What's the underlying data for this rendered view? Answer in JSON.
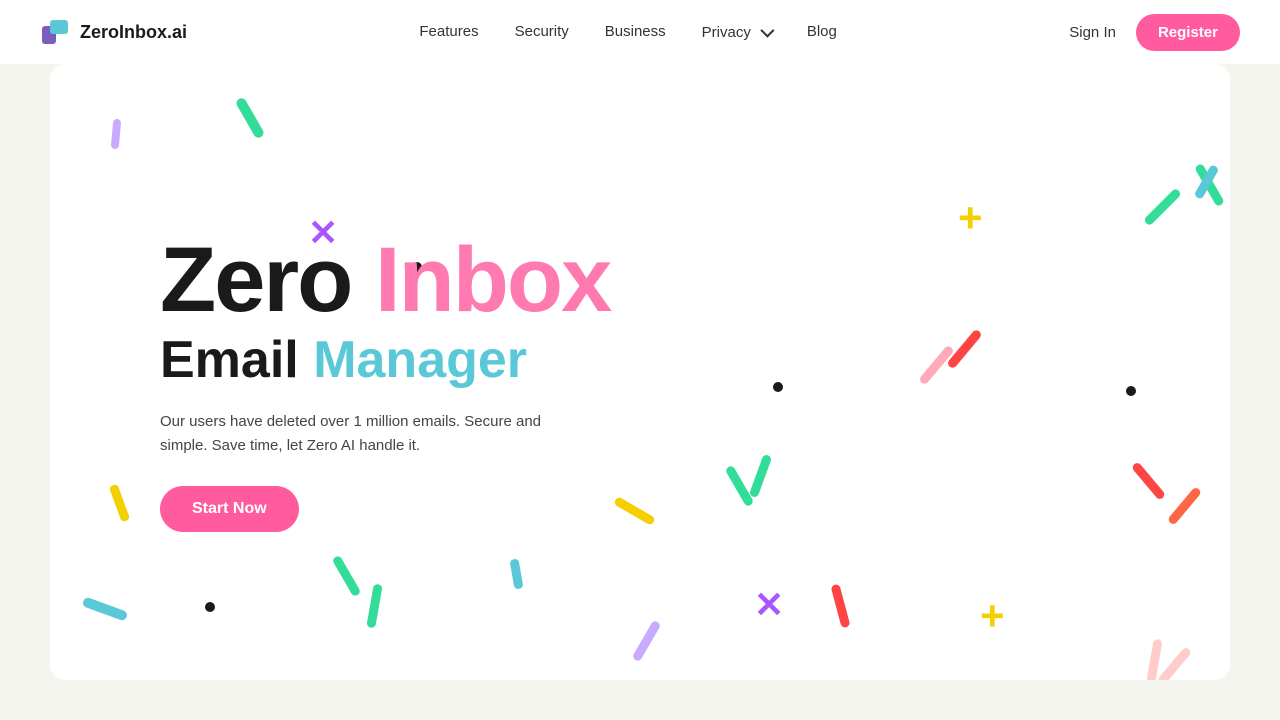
{
  "nav": {
    "logo_text": "ZeroInbox.ai",
    "links": [
      {
        "label": "Features",
        "id": "features"
      },
      {
        "label": "Security",
        "id": "security"
      },
      {
        "label": "Business",
        "id": "business"
      },
      {
        "label": "Privacy",
        "id": "privacy",
        "has_dropdown": true
      },
      {
        "label": "Blog",
        "id": "blog"
      }
    ],
    "signin_label": "Sign In",
    "register_label": "Register"
  },
  "hero": {
    "title_black": "Zero ",
    "title_pink": "Inbox",
    "subtitle_black": "Email ",
    "subtitle_blue": "Manager",
    "description": "Our users have deleted over 1 million emails. Secure and simple. Save time, let Zero AI handle it.",
    "cta_label": "Start Now"
  },
  "shapes": {
    "accent1": "#ff5b9e",
    "accent2": "#5bc8d8",
    "accent3": "#f5d000",
    "accent4": "#ff4444",
    "accent5": "#aa55ff",
    "accent6": "#33dd99",
    "accent7": "#ffb347"
  }
}
